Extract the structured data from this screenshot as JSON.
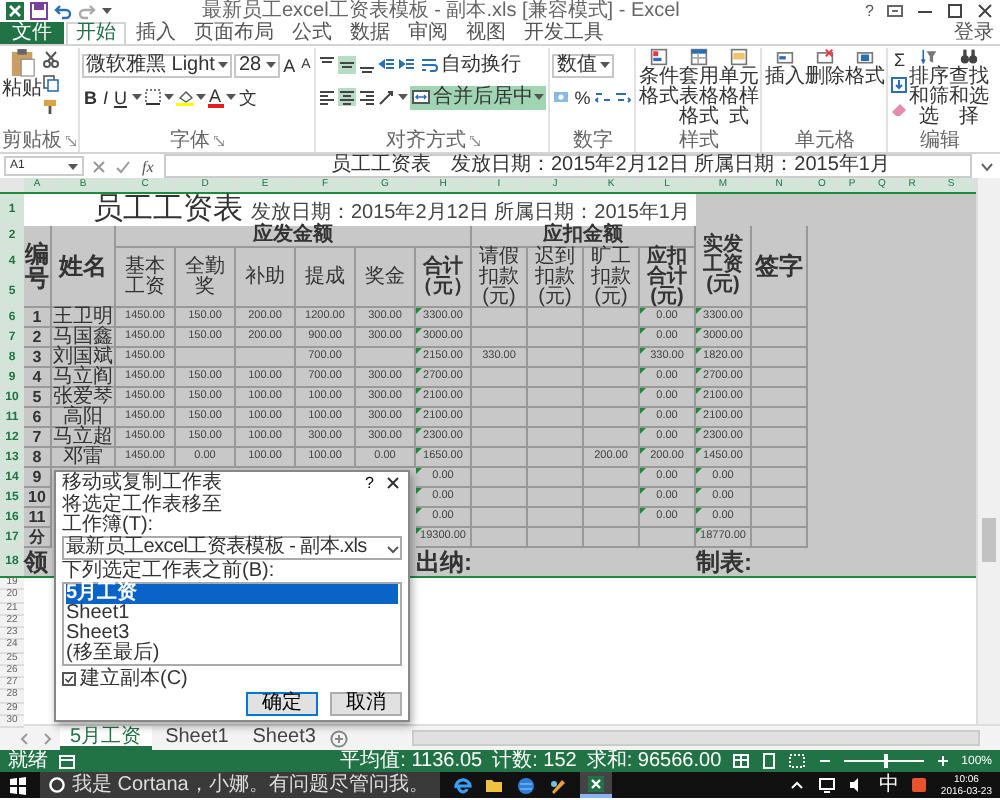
{
  "window": {
    "title": "最新员工excel工资表模板 - 副本.xls [兼容模式] - Excel",
    "help": "?"
  },
  "tabs": [
    {
      "label": "文件",
      "kind": "file",
      "selected": false
    },
    {
      "label": "开始",
      "kind": "tab",
      "selected": true
    },
    {
      "label": "插入",
      "kind": "tab",
      "selected": false
    },
    {
      "label": "页面布局",
      "kind": "tab",
      "selected": false
    },
    {
      "label": "公式",
      "kind": "tab",
      "selected": false
    },
    {
      "label": "数据",
      "kind": "tab",
      "selected": false
    },
    {
      "label": "审阅",
      "kind": "tab",
      "selected": false
    },
    {
      "label": "视图",
      "kind": "tab",
      "selected": false
    },
    {
      "label": "开发工具",
      "kind": "tab",
      "selected": false
    }
  ],
  "sign_in": "登录",
  "ribbon": {
    "clipboard": {
      "label": "剪贴板",
      "paste": "粘贴"
    },
    "font": {
      "label": "字体",
      "font_name": "微软雅黑 Light",
      "font_size": "28",
      "grow": "A",
      "shrink": "A",
      "bold": "B",
      "italic": "I",
      "underline": "U",
      "font_color": "A",
      "phonetic": "文"
    },
    "alignment": {
      "label": "对齐方式",
      "wrap_text": "自动换行",
      "merge_center": "合并后居中",
      "merge_on": true,
      "vertical": [
        {
          "selected": false
        },
        {
          "selected": true
        },
        {
          "selected": false
        }
      ],
      "horizontal": [
        {
          "selected": false
        },
        {
          "selected": true
        },
        {
          "selected": false
        }
      ]
    },
    "number": {
      "label": "数字",
      "format": "数值",
      "percent": "%"
    },
    "styles": {
      "label": "样式",
      "buttons": [
        "条件格式",
        "套用表格格式",
        "单元格样式"
      ]
    },
    "cells": {
      "label": "单元格",
      "buttons": [
        "插入",
        "删除",
        "格式"
      ]
    },
    "editing": {
      "label": "编辑",
      "sum": "Σ",
      "buttons": [
        "排序和筛选",
        "查找和选择"
      ]
    }
  },
  "formula_bar": {
    "name_box": "A1",
    "fx": "fx",
    "content": "员工工资表　发放日期：2015年2月12日 所属日期：2015年1月"
  },
  "sheet": {
    "columns_selected": true,
    "rows_selected": true,
    "columns": [
      "A",
      "B",
      "C",
      "D",
      "E",
      "F",
      "G",
      "H",
      "I",
      "J",
      "K",
      "L",
      "M",
      "N",
      "O",
      "P",
      "Q",
      "R",
      "S"
    ],
    "title_row": {
      "row": "1",
      "title": "员工工资表",
      "note": "发放日期：2015年2月12日 所属日期：2015年1月"
    },
    "header": {
      "rows": [
        "2",
        "4",
        "5"
      ],
      "no": "编号",
      "name": "姓名",
      "payable": "应发金额",
      "payable_items": [
        "基本工资",
        "全勤奖",
        "补助",
        "提成",
        "奖金",
        "合计（元）"
      ],
      "deductions": "应扣金额",
      "deduction_items": [
        "请假扣款(元)",
        "迟到扣款(元)",
        "旷工扣款(元)",
        "应扣合计(元)"
      ],
      "net_pay": "实发工资(元)",
      "signature": "签字"
    },
    "rows": [
      {
        "row": "6",
        "flagged": true,
        "cells": [
          "1",
          "王卫明",
          "1450.00",
          "150.00",
          "200.00",
          "1200.00",
          "300.00",
          "3300.00",
          "",
          "",
          "",
          "0.00",
          "3300.00",
          ""
        ]
      },
      {
        "row": "7",
        "flagged": true,
        "cells": [
          "2",
          "马国鑫",
          "1450.00",
          "150.00",
          "200.00",
          "900.00",
          "300.00",
          "3000.00",
          "",
          "",
          "",
          "0.00",
          "3000.00",
          ""
        ]
      },
      {
        "row": "8",
        "flagged": true,
        "cells": [
          "3",
          "刘国斌",
          "1450.00",
          "",
          "",
          "700.00",
          "",
          "2150.00",
          "330.00",
          "",
          "",
          "330.00",
          "1820.00",
          ""
        ]
      },
      {
        "row": "9",
        "flagged": true,
        "cells": [
          "4",
          "马立阎",
          "1450.00",
          "150.00",
          "100.00",
          "700.00",
          "300.00",
          "2700.00",
          "",
          "",
          "",
          "0.00",
          "2700.00",
          ""
        ]
      },
      {
        "row": "10",
        "flagged": true,
        "cells": [
          "5",
          "张爱琴",
          "1450.00",
          "150.00",
          "100.00",
          "100.00",
          "300.00",
          "2100.00",
          "",
          "",
          "",
          "0.00",
          "2100.00",
          ""
        ]
      },
      {
        "row": "11",
        "flagged": true,
        "cells": [
          "6",
          "高阳",
          "1450.00",
          "150.00",
          "100.00",
          "100.00",
          "300.00",
          "2100.00",
          "",
          "",
          "",
          "0.00",
          "2100.00",
          ""
        ]
      },
      {
        "row": "12",
        "flagged": true,
        "cells": [
          "7",
          "马立超",
          "1450.00",
          "150.00",
          "100.00",
          "300.00",
          "300.00",
          "2300.00",
          "",
          "",
          "",
          "0.00",
          "2300.00",
          ""
        ]
      },
      {
        "row": "13",
        "flagged": true,
        "cells": [
          "8",
          "邓雷",
          "1450.00",
          "0.00",
          "100.00",
          "100.00",
          "0.00",
          "1650.00",
          "",
          "",
          "200.00",
          "200.00",
          "1450.00",
          ""
        ]
      },
      {
        "row": "14",
        "flagged": true,
        "cells": [
          "9",
          "",
          "",
          "",
          "",
          "",
          "",
          "0.00",
          "",
          "",
          "",
          "0.00",
          "0.00",
          ""
        ]
      },
      {
        "row": "15",
        "flagged": true,
        "cells": [
          "10",
          "",
          "",
          "",
          "",
          "",
          "",
          "0.00",
          "",
          "",
          "",
          "0.00",
          "0.00",
          ""
        ]
      },
      {
        "row": "16",
        "flagged": true,
        "cells": [
          "11",
          "",
          "",
          "",
          "",
          "",
          "",
          "0.00",
          "",
          "",
          "",
          "0.00",
          "0.00",
          ""
        ]
      },
      {
        "row": "17",
        "flagged": true,
        "cells": [
          "分",
          "",
          "",
          "",
          "",
          "",
          "",
          "19300.00",
          "",
          "",
          "",
          "",
          "18770.00",
          ""
        ]
      }
    ],
    "footer_row": {
      "row": "18",
      "received": "领",
      "cashier": "出纳:",
      "prepared": "制表:"
    },
    "empty_rows": [
      "19",
      "20",
      "21",
      "22",
      "23",
      "24",
      "25",
      "26",
      "27",
      "28",
      "29",
      "30"
    ]
  },
  "sheet_tabs": [
    {
      "label": "5月工资",
      "selected": true
    },
    {
      "label": "Sheet1",
      "selected": false
    },
    {
      "label": "Sheet3",
      "selected": false
    }
  ],
  "status_bar": {
    "state": "就绪",
    "average": "平均值: 1136.05",
    "count": "计数: 152",
    "sum": "求和: 96566.00",
    "zoom": {
      "level": 0.5,
      "reading": "100%"
    }
  },
  "taskbar": {
    "search": "我是 Cortana，小娜。有问题尽管问我。",
    "time": "10:06",
    "date": "2016-03-23",
    "ime": "中"
  },
  "dialog": {
    "title": "移动或复制工作表",
    "help": "?",
    "instruction": "将选定工作表移至",
    "workbook_label": "工作簿(T):",
    "workbook": "最新员工excel工资表模板 - 副本.xls",
    "before_label": "下列选定工作表之前(B):",
    "sheets": [
      {
        "label": "5月工资",
        "selected": true
      },
      {
        "label": "Sheet1",
        "selected": false
      },
      {
        "label": "Sheet3",
        "selected": false
      },
      {
        "label": "(移至最后)",
        "selected": false
      }
    ],
    "copy": {
      "label": "建立副本(C)",
      "checked": true
    },
    "buttons": [
      {
        "label": "确定",
        "default": true
      },
      {
        "label": "取消",
        "default": false
      }
    ]
  }
}
